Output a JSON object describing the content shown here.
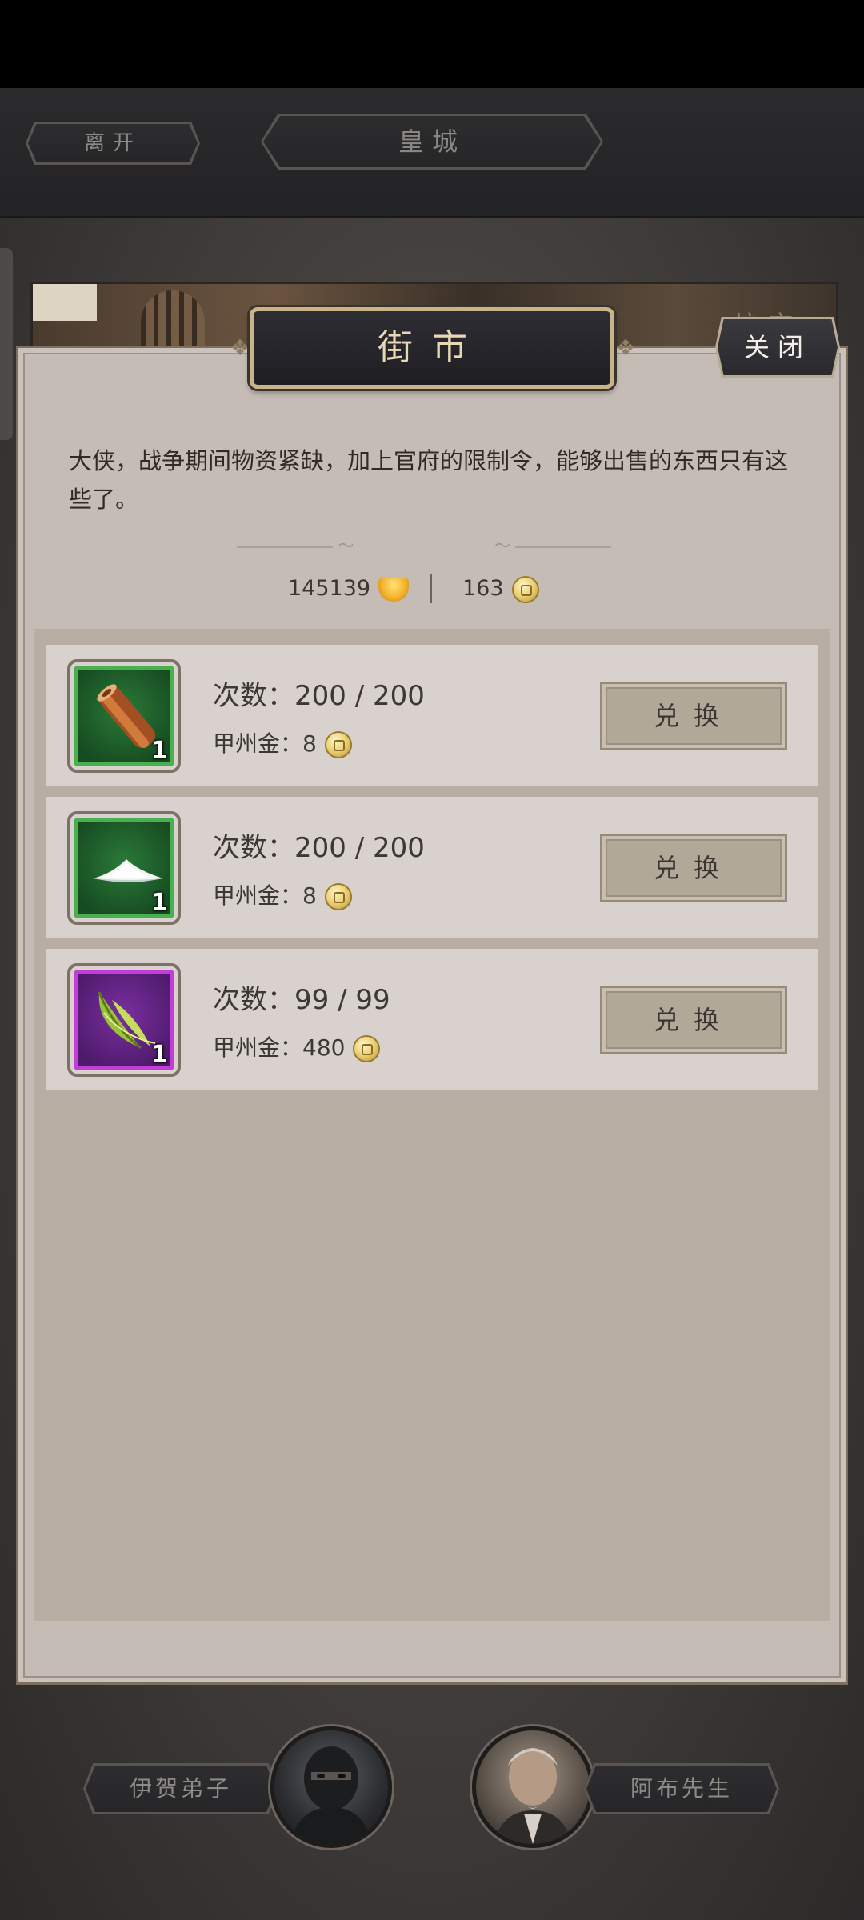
{
  "top_nav": {
    "leave_label": "离开",
    "location_title": "皇城"
  },
  "banner": {
    "faded_text": "坊市"
  },
  "market": {
    "title": "街市",
    "close_label": "关闭",
    "intro": "大侠，战争期间物资紧缺，加上官府的限制令，能够出售的东西只有这些了。",
    "gold_amount": "145139",
    "coin_amount": "163"
  },
  "items": [
    {
      "icon": "cinnamon-bark-icon",
      "rarity": "green",
      "quantity": "1",
      "count_text": "次数：200 / 200",
      "price_label": "甲州金：",
      "price_value": "8",
      "button_label": "兑换"
    },
    {
      "icon": "salt-pile-icon",
      "rarity": "green",
      "quantity": "1",
      "count_text": "次数：200 / 200",
      "price_label": "甲州金：",
      "price_value": "8",
      "button_label": "兑换"
    },
    {
      "icon": "herb-leaf-icon",
      "rarity": "purple",
      "quantity": "1",
      "count_text": "次数：99 / 99",
      "price_label": "甲州金：",
      "price_value": "480",
      "button_label": "兑换"
    }
  ],
  "npcs": {
    "left_name": "伊贺弟子",
    "right_name": "阿布先生"
  },
  "colors": {
    "panel_bg": "#c5bcb6",
    "title_gold": "#e8d8b4",
    "rarity_green": "#49b04f",
    "rarity_purple": "#c43dda"
  }
}
